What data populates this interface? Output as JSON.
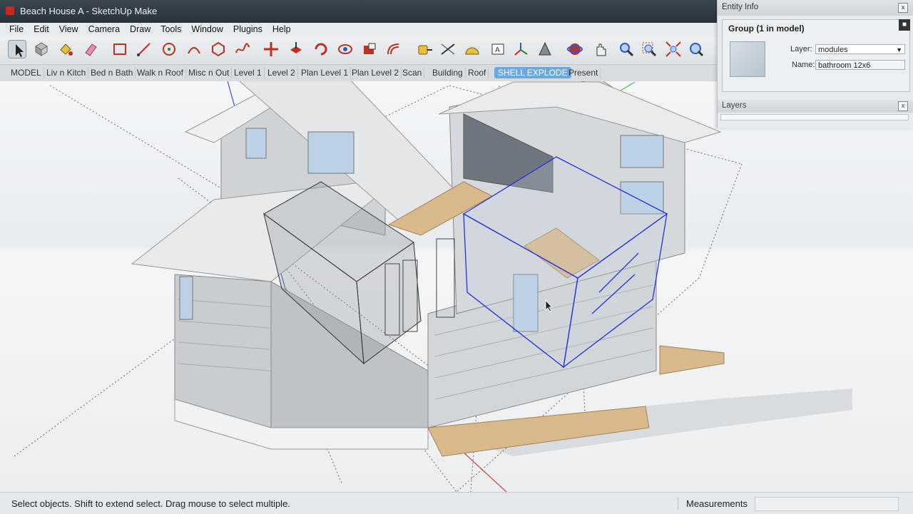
{
  "window": {
    "title": "Beach House A - SketchUp Make"
  },
  "menu": [
    "File",
    "Edit",
    "View",
    "Camera",
    "Draw",
    "Tools",
    "Window",
    "Plugins",
    "Help"
  ],
  "toolbar": [
    {
      "name": "select-tool-icon",
      "selected": true
    },
    {
      "name": "component-tool-icon"
    },
    {
      "name": "paint-bucket-icon"
    },
    {
      "name": "eraser-icon"
    },
    {
      "name": "rectangle-tool-icon"
    },
    {
      "name": "line-tool-icon"
    },
    {
      "name": "circle-tool-icon"
    },
    {
      "name": "arc-tool-icon"
    },
    {
      "name": "polygon-tool-icon"
    },
    {
      "name": "freehand-tool-icon"
    },
    {
      "name": "move-tool-icon"
    },
    {
      "name": "push-pull-icon"
    },
    {
      "name": "rotate-tool-icon"
    },
    {
      "name": "follow-me-icon"
    },
    {
      "name": "scale-tool-icon"
    },
    {
      "name": "offset-tool-icon"
    },
    {
      "name": "tape-measure-icon"
    },
    {
      "name": "dimension-tool-icon"
    },
    {
      "name": "protractor-icon"
    },
    {
      "name": "text-tool-icon"
    },
    {
      "name": "axes-tool-icon"
    },
    {
      "name": "3d-text-icon"
    },
    {
      "name": "orbit-tool-icon"
    },
    {
      "name": "pan-tool-icon"
    },
    {
      "name": "zoom-tool-icon"
    },
    {
      "name": "zoom-window-icon"
    },
    {
      "name": "zoom-extents-icon"
    },
    {
      "name": "previous-view-icon"
    }
  ],
  "scene_tabs": [
    "MODEL",
    "Liv n Kitch",
    "Bed n Bath",
    "Walk n Roof",
    "Misc n Out",
    "Level 1",
    "Level 2",
    "Plan Level 1",
    "Plan Level 2",
    "Scan",
    "Building",
    "Roof",
    "SHELL EXPLODE",
    "Present"
  ],
  "active_tab": "SHELL EXPLODE",
  "entity_info": {
    "title": "Entity Info",
    "group_title": "Group (1 in model)",
    "layer_label": "Layer:",
    "layer_value": "modules",
    "name_label": "Name:",
    "name_value": "bathroom 12x6",
    "close": "x"
  },
  "layers_panel": {
    "title": "Layers",
    "close": "x"
  },
  "status": {
    "message": "Select objects. Shift to extend select. Drag mouse to select multiple.",
    "measurements_label": "Measurements",
    "measurements_value": ""
  },
  "colors": {
    "accent": "#6aa9e0",
    "selection": "#2233dd",
    "wood": "#d9b98c"
  }
}
